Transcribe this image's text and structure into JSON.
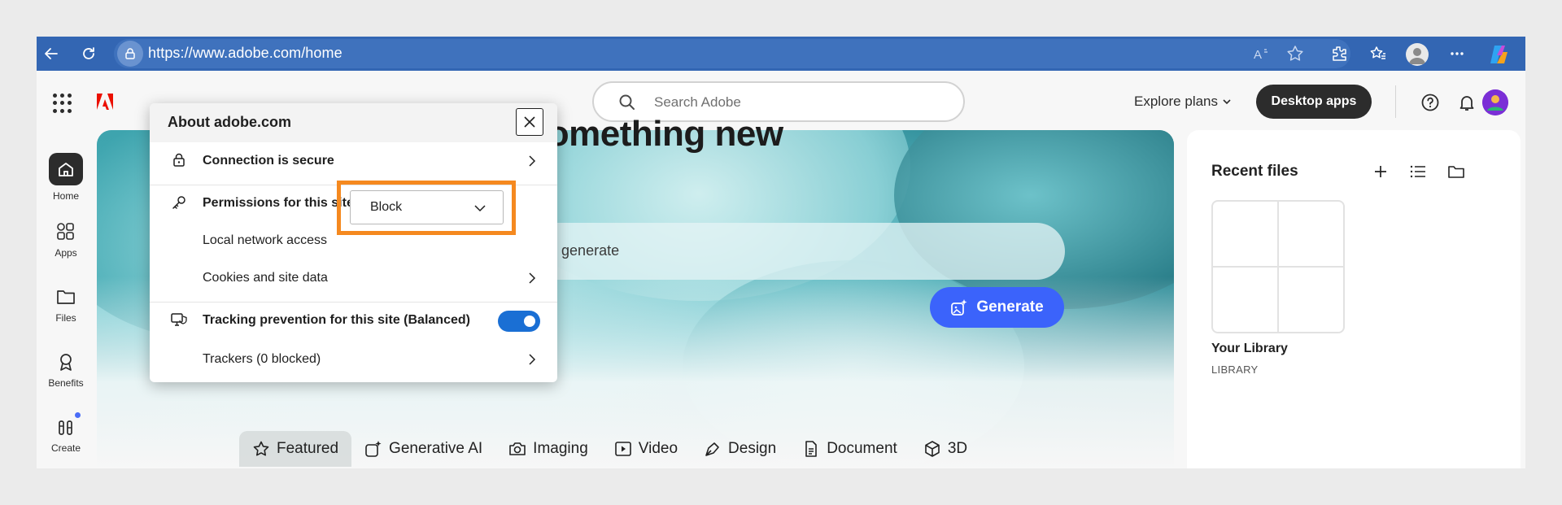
{
  "browser": {
    "url": "https://www.adobe.com/home"
  },
  "header": {
    "search_placeholder": "Search Adobe",
    "explore_label": "Explore plans",
    "desktop_apps_label": "Desktop apps"
  },
  "rail": {
    "items": [
      {
        "label": "Home"
      },
      {
        "label": "Apps"
      },
      {
        "label": "Files"
      },
      {
        "label": "Benefits"
      },
      {
        "label": "Create"
      }
    ]
  },
  "hero": {
    "title": "ate something new",
    "prompt_text": "ant to generate",
    "generate_label": "Generate"
  },
  "categories": [
    {
      "label": "Featured"
    },
    {
      "label": "Generative AI"
    },
    {
      "label": "Imaging"
    },
    {
      "label": "Video"
    },
    {
      "label": "Design"
    },
    {
      "label": "Document"
    },
    {
      "label": "3D"
    }
  ],
  "recent": {
    "title": "Recent files",
    "library_name": "Your Library",
    "library_sub": "LIBRARY"
  },
  "popup": {
    "title": "About adobe.com",
    "connection": "Connection is secure",
    "permissions": "Permissions for this site",
    "local_network": "Local network access",
    "local_network_value": "Block",
    "cookies": "Cookies and site data",
    "tracking": "Tracking prevention for this site (Balanced)",
    "trackers": "Trackers (0 blocked)"
  },
  "colors": {
    "browser_bar": "#3366b3",
    "generate": "#3b63fb",
    "highlight": "#f5891f",
    "toggle_on": "#1a6fd4"
  }
}
